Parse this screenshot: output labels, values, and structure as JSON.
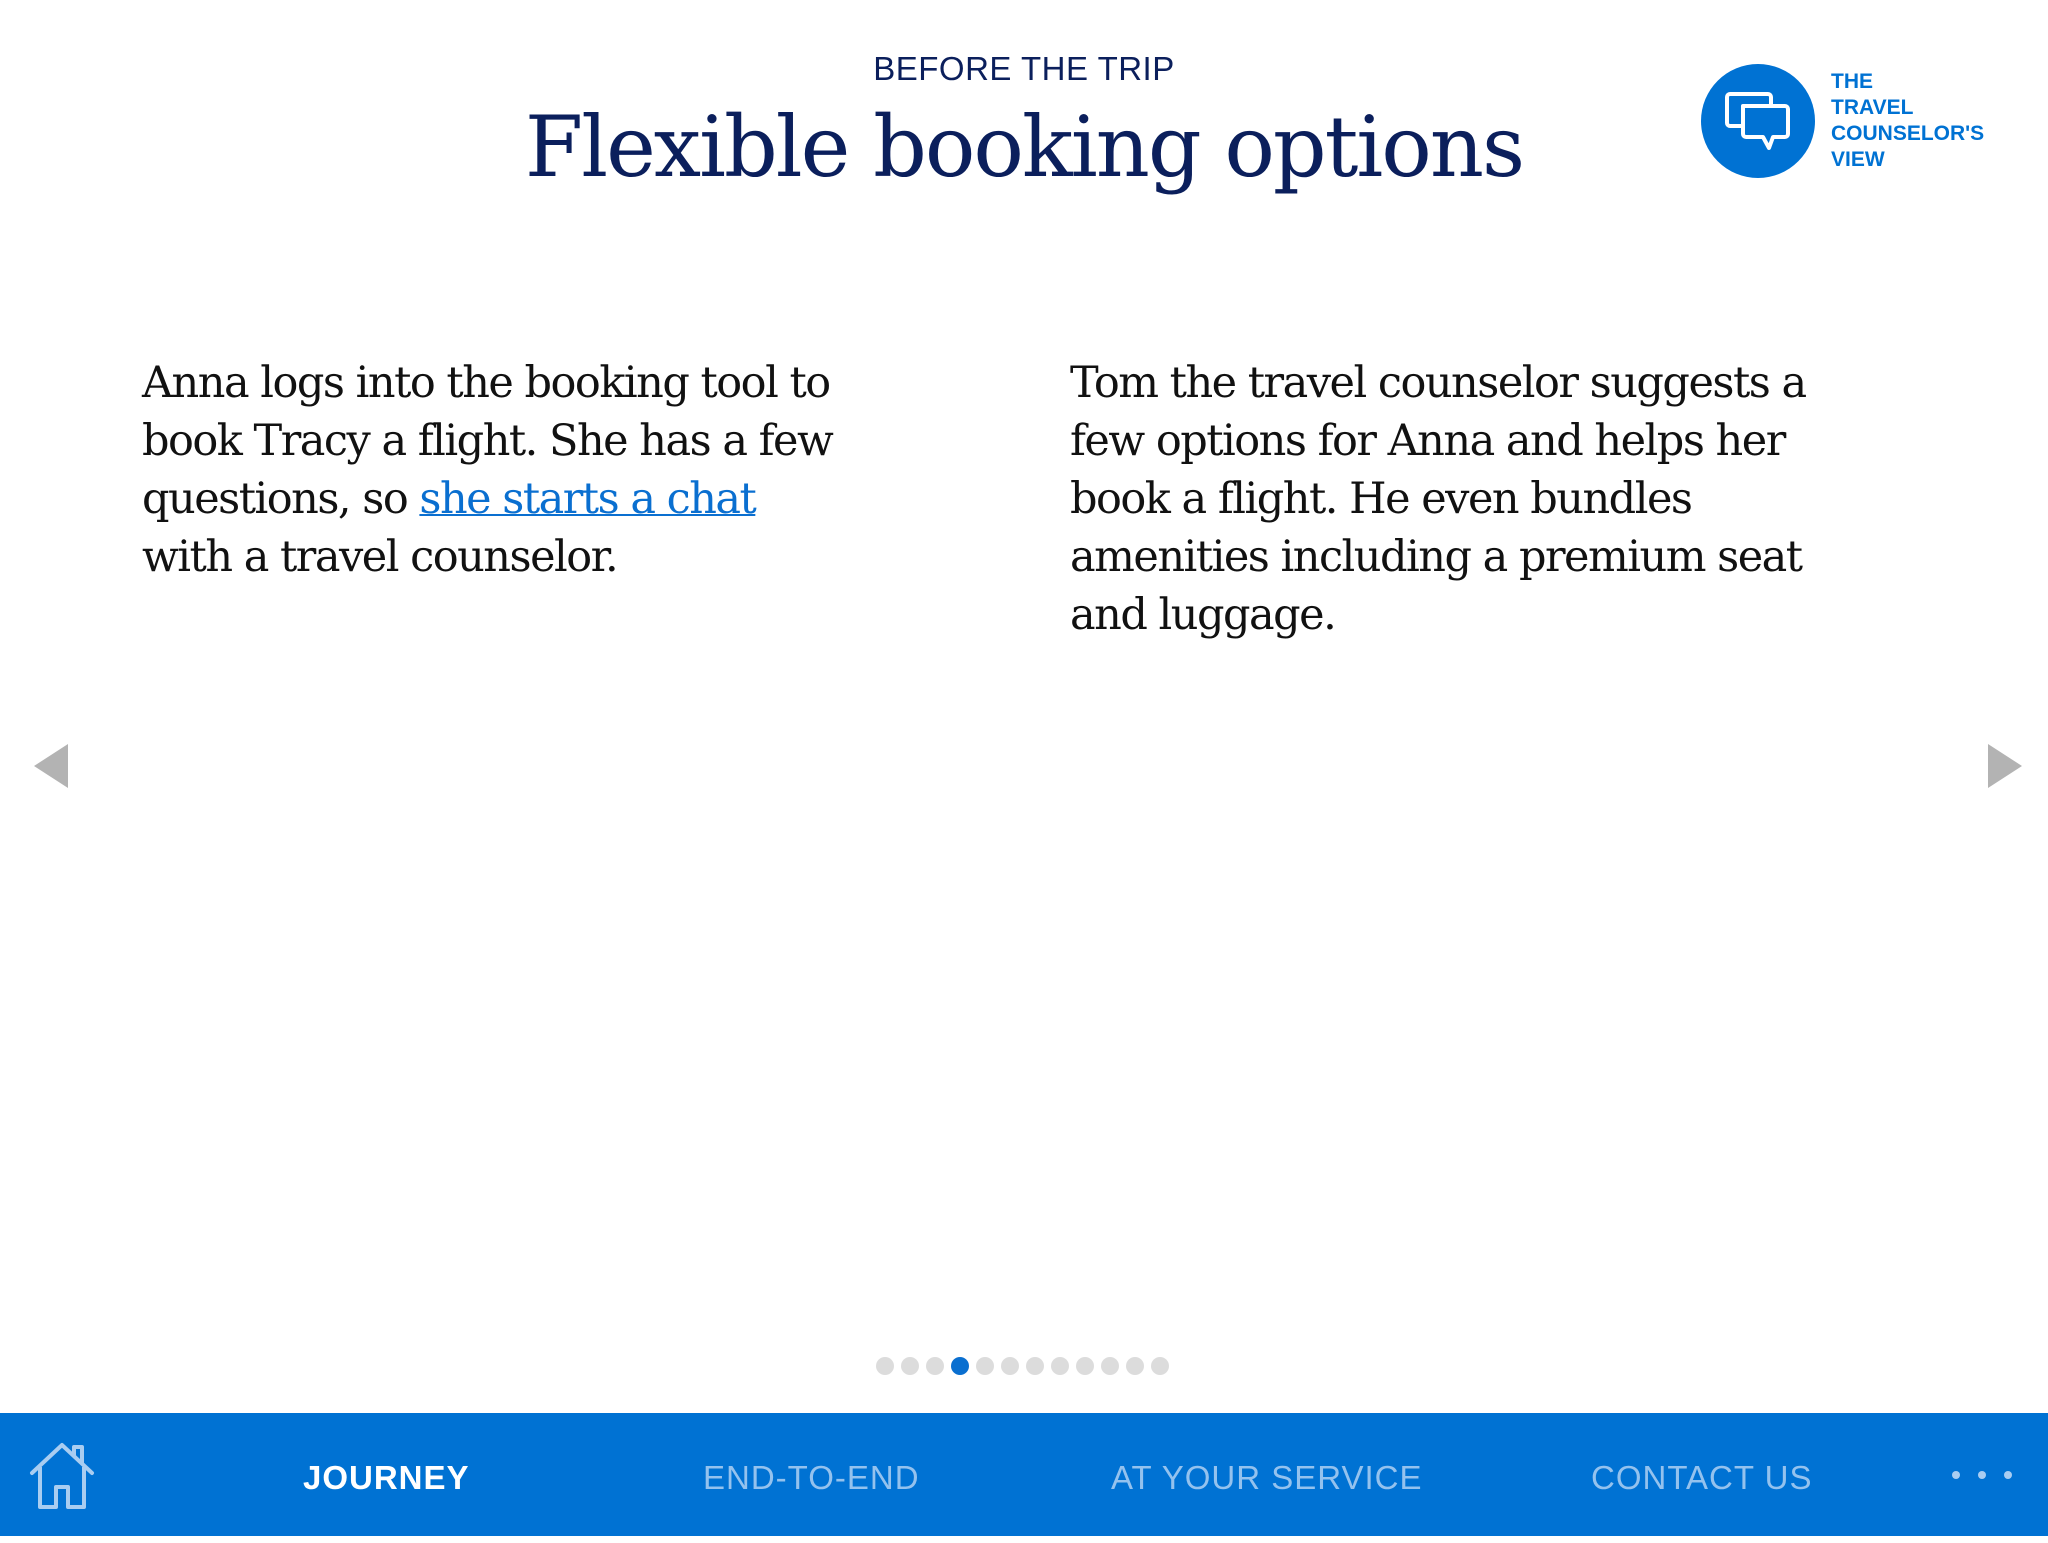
{
  "header": {
    "eyebrow": "BEFORE THE TRIP",
    "title": "Flexible booking options"
  },
  "badge": {
    "icon": "chat-bubbles-icon",
    "lines": [
      "THE",
      "TRAVEL",
      "COUNSELOR'S",
      "VIEW"
    ]
  },
  "left_column": {
    "before_link": "Anna logs into the booking tool to book Tracy a flight. She has a few questions, so ",
    "link": "she starts a chat",
    "after_link": " with a travel counselor."
  },
  "right_column": {
    "text": "Tom the travel counselor suggests a few options for Anna and helps her book a flight. He even bundles amenities including a premium seat and luggage."
  },
  "pager": {
    "count": 12,
    "active_index": 3
  },
  "navbar": {
    "home_icon": "home-icon",
    "items": [
      {
        "label": "JOURNEY",
        "active": true
      },
      {
        "label": "END-TO-END",
        "active": false
      },
      {
        "label": "AT YOUR SERVICE",
        "active": false
      },
      {
        "label": "CONTACT US",
        "active": false
      }
    ],
    "more_icon": "more-dots-icon"
  },
  "colors": {
    "brand_blue": "#0072d3",
    "title_navy": "#0b1f5c",
    "link_blue": "#0a6fd0",
    "dot_inactive": "#dcdcdc"
  }
}
